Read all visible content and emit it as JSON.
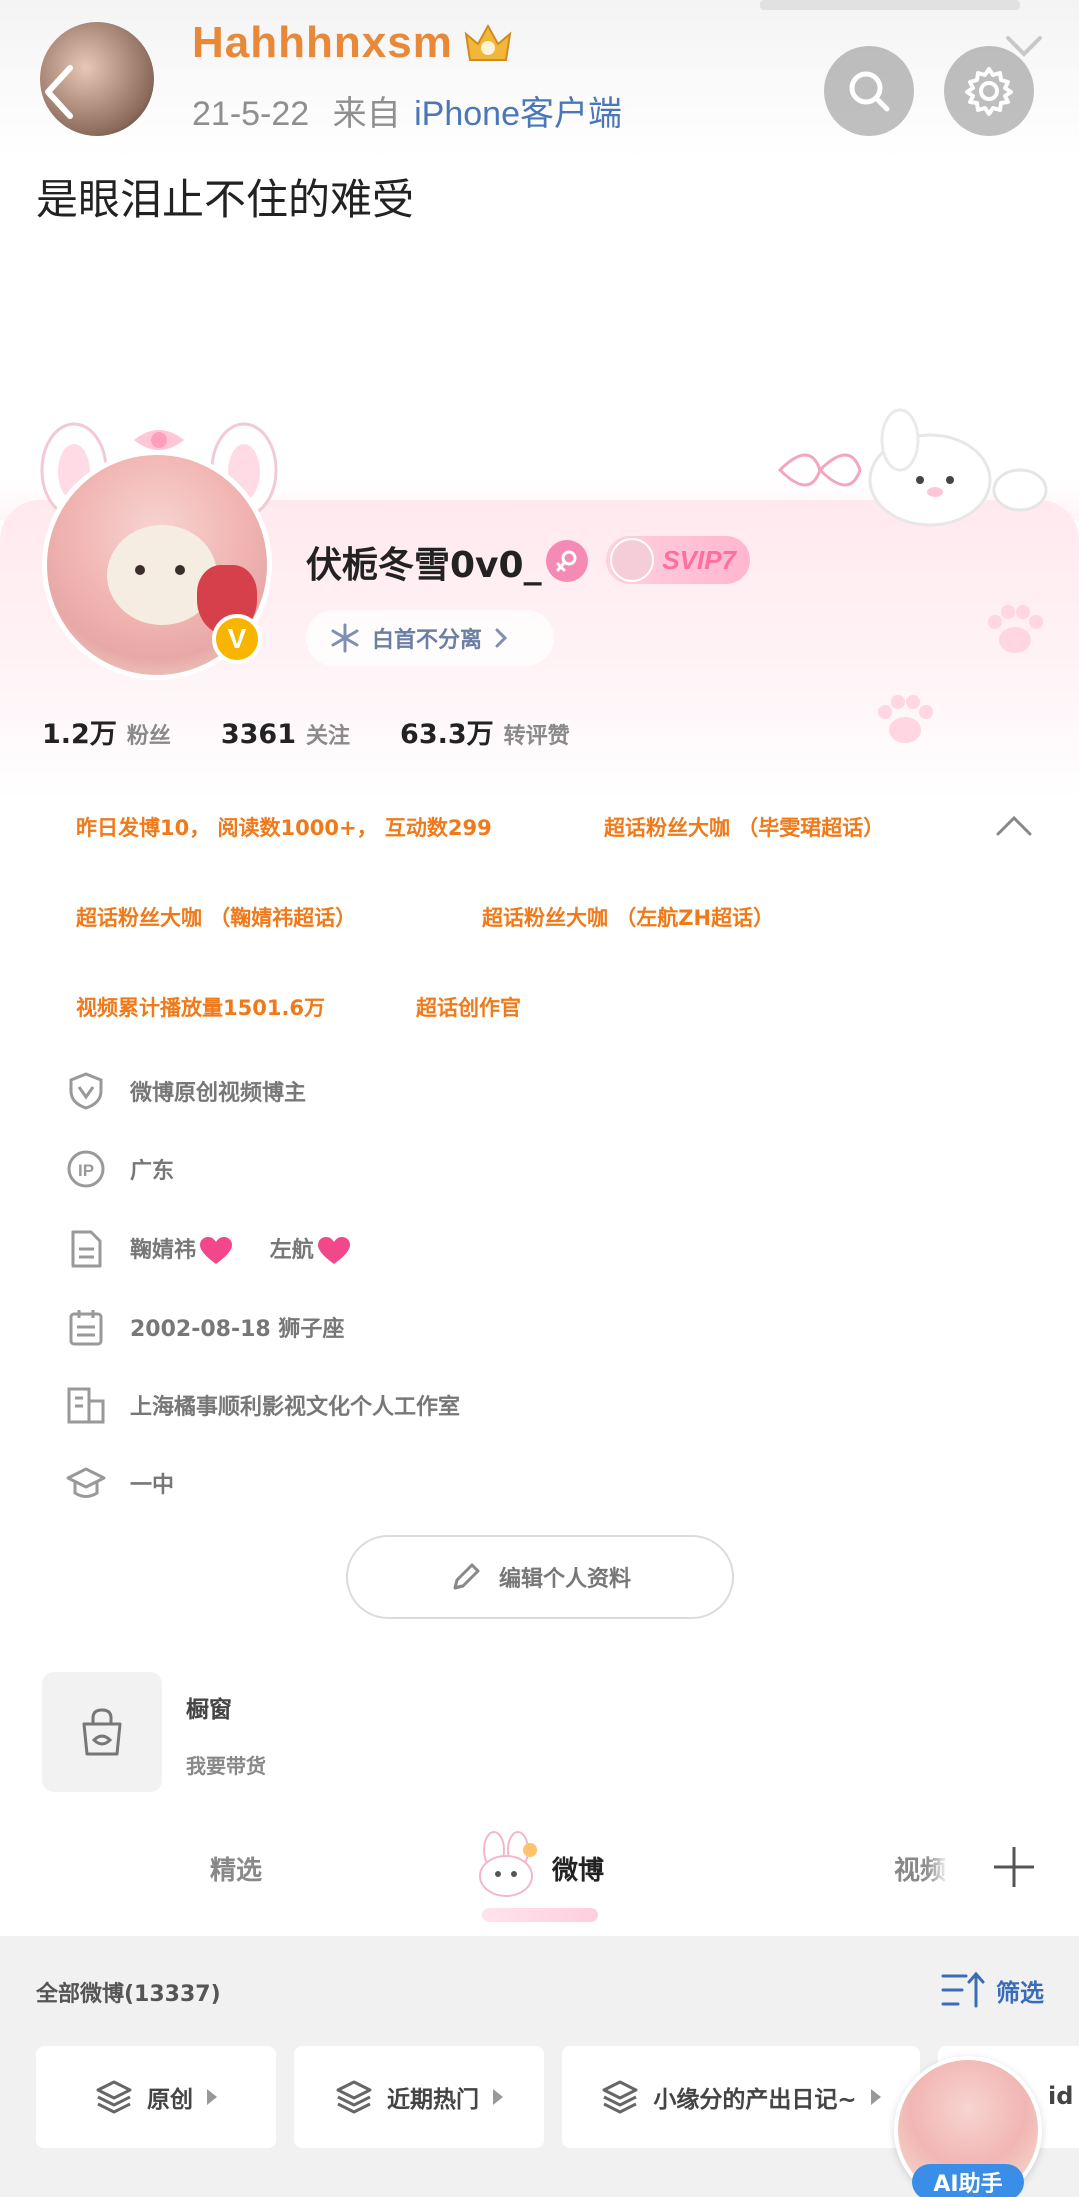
{
  "repost": {
    "author": "Hahhhnxsm",
    "date": "21-5-22",
    "from_prefix": "来自",
    "source": "iPhone客户端",
    "text": "是眼泪止不住的难受"
  },
  "profile": {
    "nickname": "伏栀冬雪0v0_",
    "verified_mark": "V",
    "vip_label": "SVIP7",
    "fan_tag": "白首不分离",
    "stats": [
      {
        "value": "1.2万",
        "label": "粉丝"
      },
      {
        "value": "3361",
        "label": "关注"
      },
      {
        "value": "63.3万",
        "label": "转评赞"
      }
    ],
    "honors": [
      "昨日发博10， 阅读数1000+， 互动数299",
      "超话粉丝大咖 （毕雯珺超话）",
      "超话粉丝大咖 （鞠婧祎超话）",
      "超话粉丝大咖 （左航ZH超话）",
      "视频累计播放量1501.6万",
      "超话创作官"
    ],
    "info": {
      "verify": "微博原创视频博主",
      "ip": "广东",
      "intro_a": "鞠婧祎",
      "intro_b": "左航",
      "birthday": "2002-08-18  狮子座",
      "company": "上海橘事顺利影视文化个人工作室",
      "school": "一中"
    },
    "edit_button": "编辑个人资料"
  },
  "shop": {
    "title": "橱窗",
    "subtitle": "我要带货"
  },
  "tabs": [
    {
      "label": "精选",
      "active": false
    },
    {
      "label": "微博",
      "active": true
    },
    {
      "label": "视频",
      "active": false
    }
  ],
  "feed": {
    "title": "全部微博(13337)",
    "filter_label": "筛选",
    "chips": [
      "原创",
      "近期热门",
      "小缘分的产出日记~"
    ],
    "chip_cut": "id",
    "ai_label": "AI助手"
  },
  "colors": {
    "honor_orange": "#f07a1a",
    "link_blue": "#4b77b8",
    "name_orange": "#e8893a",
    "pink_bg": "#ffe9ef"
  },
  "icons": [
    "back-icon",
    "crown-icon",
    "search-icon",
    "gear-icon",
    "female-icon",
    "snowflake-icon",
    "shield-v-icon",
    "ip-icon",
    "document-icon",
    "calendar-icon",
    "building-icon",
    "graduation-cap-icon",
    "pencil-icon",
    "shopping-bag-icon",
    "plus-icon",
    "filter-icon",
    "layers-icon"
  ]
}
